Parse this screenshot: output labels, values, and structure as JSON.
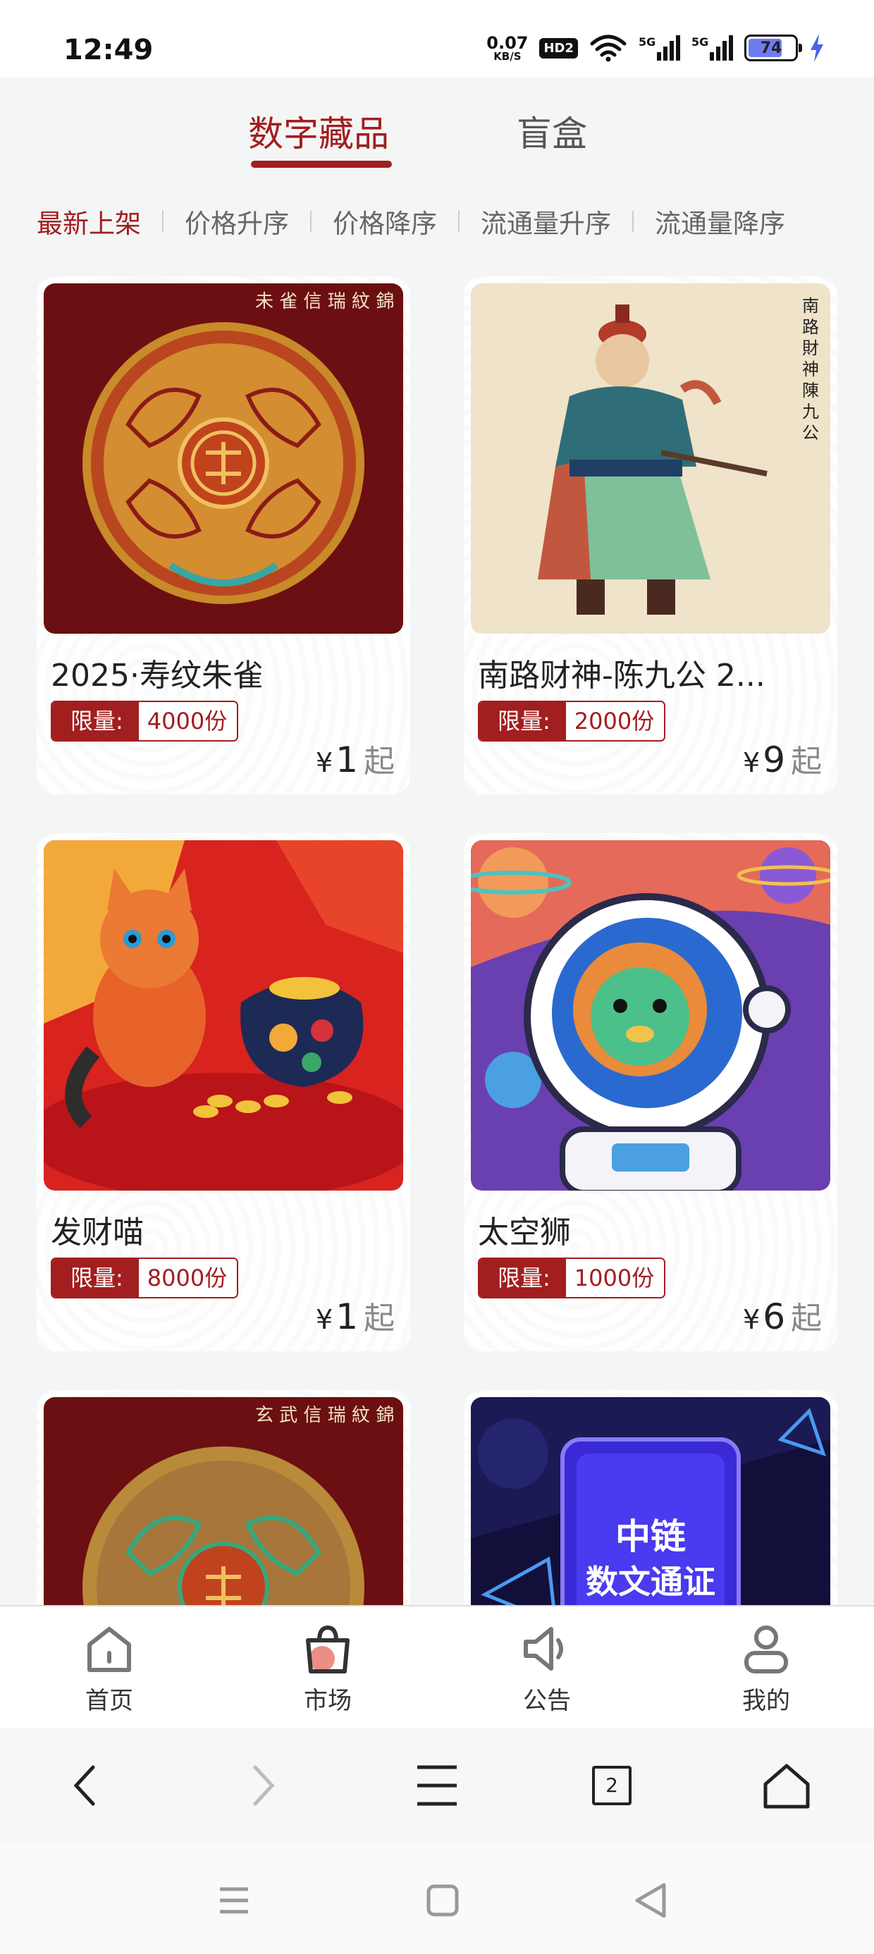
{
  "status_bar": {
    "time": "12:49",
    "net_speed_value": "0.07",
    "net_speed_unit": "KB/S",
    "hd_badge": "HD2",
    "signal1_label": "5G",
    "signal2_label": "5G",
    "battery_level": "74"
  },
  "tabs": [
    {
      "label": "数字藏品",
      "active": true
    },
    {
      "label": "盲盒",
      "active": false
    }
  ],
  "sort_options": [
    "最新上架",
    "价格升序",
    "价格降序",
    "流通量升序",
    "流通量降序"
  ],
  "limit_label": "限量:",
  "price_currency": "¥",
  "price_suffix": "起",
  "products": [
    {
      "name": "2025·寿纹朱雀",
      "limit": "4000份",
      "price": "1",
      "image": "shouwen-zhuque"
    },
    {
      "name": "南路财神-陈九公 2...",
      "limit": "2000份",
      "price": "9",
      "image": "nanlu-caishen"
    },
    {
      "name": "发财喵",
      "limit": "8000份",
      "price": "1",
      "image": "facai-cat"
    },
    {
      "name": "太空狮",
      "limit": "1000份",
      "price": "6",
      "image": "space-lion"
    },
    {
      "name": "",
      "limit": "",
      "price": "",
      "image": "shouwen-green-medallion"
    },
    {
      "name": "",
      "limit": "",
      "price": "",
      "image": "zhonglian-token",
      "image_text_1": "中链",
      "image_text_2": "数文通证"
    }
  ],
  "bottom_nav": [
    {
      "label": "首页",
      "icon": "home-icon"
    },
    {
      "label": "市场",
      "icon": "shopping-bag-icon",
      "active": true
    },
    {
      "label": "公告",
      "icon": "speaker-icon"
    },
    {
      "label": "我的",
      "icon": "user-icon"
    }
  ],
  "browser_toolbar": {
    "tab_count": "2"
  },
  "colors": {
    "accent": "#a21e1f",
    "background": "#f4f5f5"
  }
}
